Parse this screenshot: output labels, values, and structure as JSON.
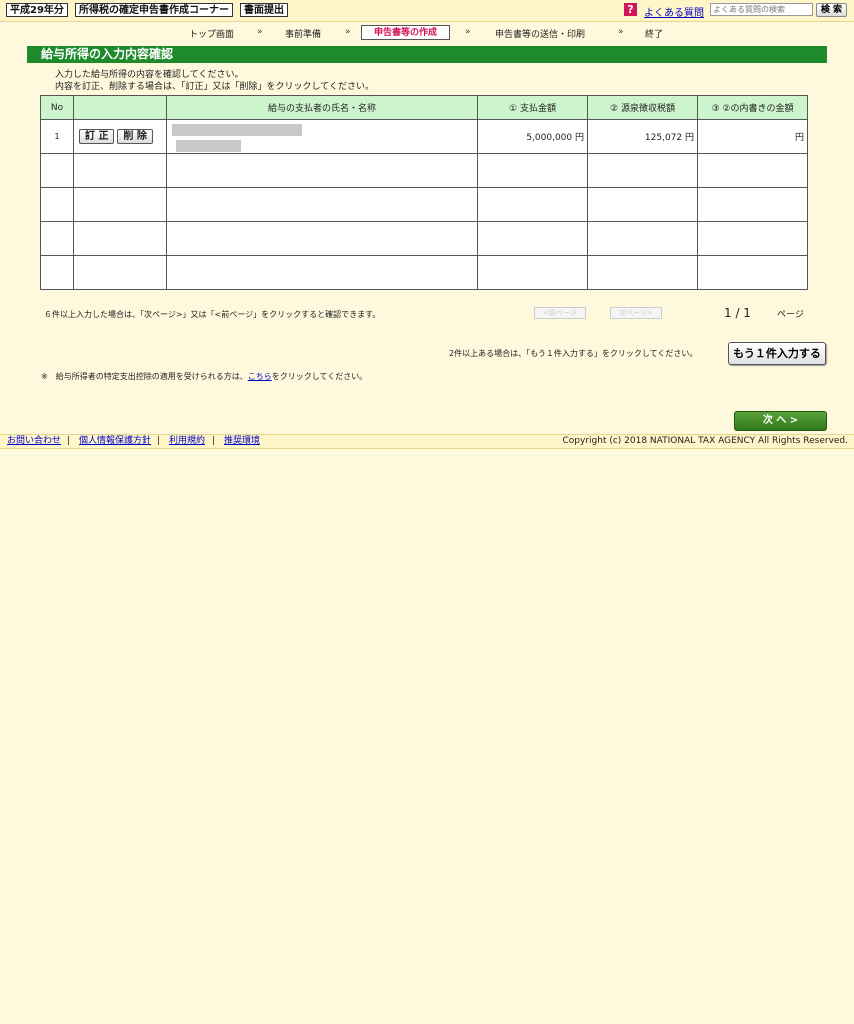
{
  "header": {
    "year": "平成29年分",
    "corner": "所得税の確定申告書作成コーナー",
    "submission": "書面提出",
    "help_icon": "?",
    "faq": "よくある質問",
    "search_placeholder": "よくある質問の検索",
    "search_button": "検 索"
  },
  "steps": [
    {
      "label": "トップ画面"
    },
    {
      "label": "事前準備"
    },
    {
      "label": "申告書等の作成"
    },
    {
      "label": "申告書等の送信・印刷"
    },
    {
      "label": "終了"
    }
  ],
  "step_arrow": "»",
  "page_title": "給与所得の入力内容確認",
  "intro": {
    "line1": "入力した給与所得の内容を確認してください。",
    "line2": "内容を訂正、削除する場合は、「訂正」又は「削除」をクリックしてください。"
  },
  "table": {
    "headers": {
      "no": "No",
      "actions": "",
      "payer": "給与の支払者の氏名・名称",
      "paid": "① 支払金額",
      "withheld": "② 源泉徴収税額",
      "breakdown": "③ ②の内書きの金額"
    },
    "row1": {
      "no": "1",
      "edit": "訂 正",
      "delete": "削 除",
      "paid": "5,000,000 円",
      "withheld": "125,072 円",
      "breakdown": "円"
    }
  },
  "pagination": {
    "note": "６件以上入力した場合は、「次ページ>」又は「<前ページ」をクリックすると確認できます。",
    "prev": "<前ページ",
    "next": "次ページ>",
    "count": "1 / 1",
    "label": "ページ"
  },
  "add_note": "2件以上ある場合は、「もう１件入力する」をクリックしてください。",
  "add_button": "もう１件入力する",
  "special_note": {
    "prefix": "※　給与所得者の特定支出控除の適用を受けられる方は、",
    "link": "こちら",
    "suffix": "をクリックしてください。"
  },
  "next_button": "次 へ >",
  "footer": {
    "contact": "お問い合わせ",
    "privacy": "個人情報保護方針",
    "terms": "利用規約",
    "env": "推奨環境",
    "separator": "|",
    "copyright": "Copyright (c) 2018 NATIONAL TAX AGENCY All Rights Reserved."
  },
  "colors": {
    "title_bar": "#1f8a2c",
    "table_header": "#cdf5cd",
    "active_step": "#d4145a",
    "background": "#fef8dc"
  }
}
